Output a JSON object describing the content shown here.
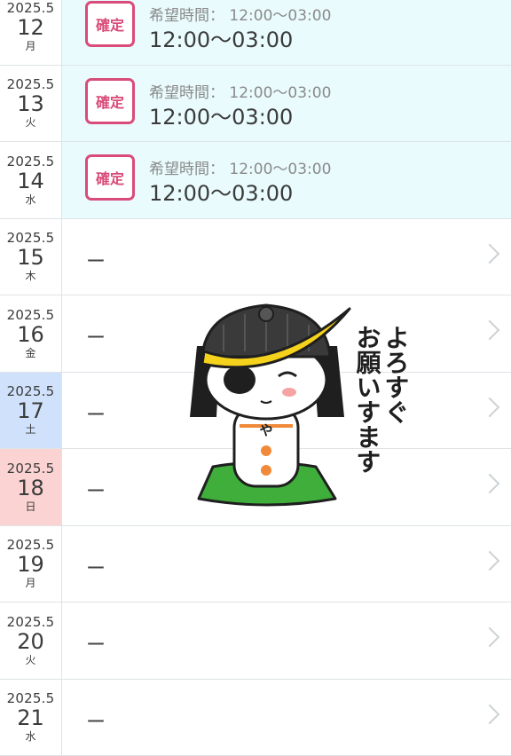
{
  "rows": [
    {
      "ym": "2025.5",
      "day": "12",
      "weekday": "月",
      "type": "confirmed",
      "badge": "確定",
      "hope_label": "希望時間：",
      "hope_time": "12:00〜03:00",
      "time": "12:00〜03:00"
    },
    {
      "ym": "2025.5",
      "day": "13",
      "weekday": "火",
      "type": "confirmed",
      "badge": "確定",
      "hope_label": "希望時間：",
      "hope_time": "12:00〜03:00",
      "time": "12:00〜03:00"
    },
    {
      "ym": "2025.5",
      "day": "14",
      "weekday": "水",
      "type": "confirmed",
      "badge": "確定",
      "hope_label": "希望時間：",
      "hope_time": "12:00〜03:00",
      "time": "12:00〜03:00"
    },
    {
      "ym": "2025.5",
      "day": "15",
      "weekday": "木",
      "type": "empty",
      "dash": "ー"
    },
    {
      "ym": "2025.5",
      "day": "16",
      "weekday": "金",
      "type": "empty",
      "dash": "ー"
    },
    {
      "ym": "2025.5",
      "day": "17",
      "weekday": "土",
      "type": "empty",
      "dash": "ー",
      "date_style": "sat"
    },
    {
      "ym": "2025.5",
      "day": "18",
      "weekday": "日",
      "type": "empty",
      "dash": "ー",
      "date_style": "sun"
    },
    {
      "ym": "2025.5",
      "day": "19",
      "weekday": "月",
      "type": "empty",
      "dash": "ー"
    },
    {
      "ym": "2025.5",
      "day": "20",
      "weekday": "火",
      "type": "empty",
      "dash": "ー"
    },
    {
      "ym": "2025.5",
      "day": "21",
      "weekday": "水",
      "type": "empty",
      "dash": "ー"
    }
  ],
  "sticker": {
    "text_col1": "よろすぐ",
    "text_col2": "お願いすます",
    "character_mark": "や"
  },
  "colors": {
    "confirmed_bg": "#e9fbfd",
    "badge": "#d94b79",
    "saturday": "#cfe1fb",
    "sunday": "#fbd3d3"
  }
}
